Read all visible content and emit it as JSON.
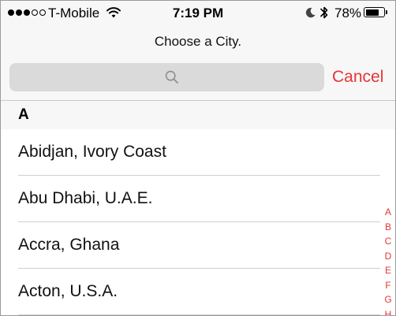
{
  "status_bar": {
    "carrier": "T-Mobile",
    "time": "7:19 PM",
    "battery_pct": "78%",
    "battery_level": 0.78,
    "signal_filled": 3,
    "signal_total": 5
  },
  "header": {
    "title": "Choose a City.",
    "search_placeholder": "",
    "cancel_label": "Cancel"
  },
  "section": {
    "letter": "A"
  },
  "cities": [
    "Abidjan, Ivory Coast",
    "Abu Dhabi, U.A.E.",
    "Accra, Ghana",
    "Acton, U.S.A."
  ],
  "index_letters": [
    "A",
    "B",
    "C",
    "D",
    "E",
    "F",
    "G",
    "H"
  ],
  "colors": {
    "accent": "#e53535",
    "header_bg": "#f7f7f7",
    "search_bg": "#dadada"
  },
  "icons": {
    "wifi": "wifi-icon",
    "moon": "moon-icon",
    "bluetooth": "bluetooth-icon",
    "battery": "battery-icon",
    "search": "search-icon"
  }
}
